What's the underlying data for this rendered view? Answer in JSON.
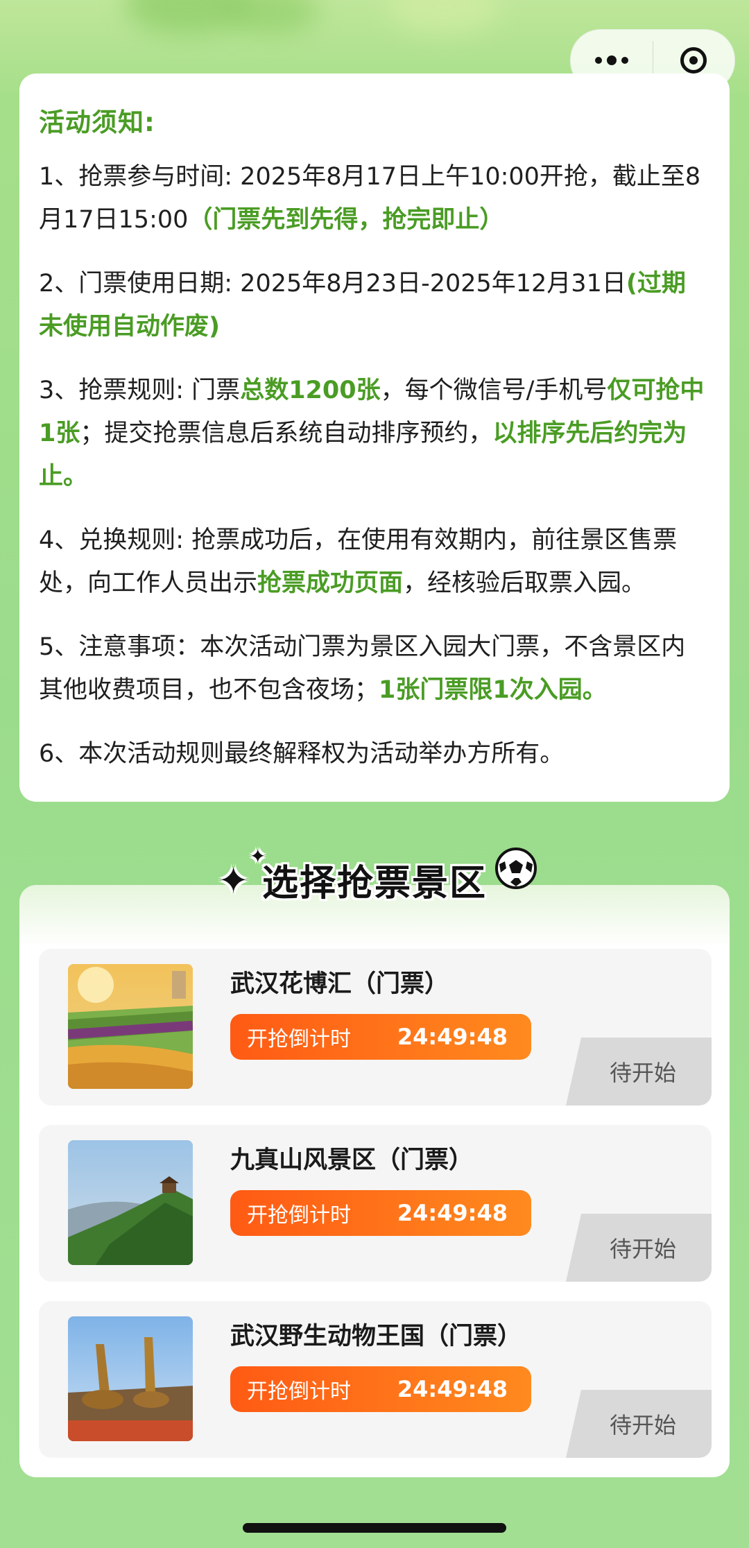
{
  "capsule": {
    "more_icon": "more-dots-icon",
    "close_icon": "target-close-icon"
  },
  "notice": {
    "title": "活动须知:",
    "items": [
      {
        "pre": "1、抢票参与时间: 2025年8月17日上午10:00开抢，截止至8月17日15:00",
        "hl": "（门票先到先得，抢完即止）"
      },
      {
        "pre": "2、门票使用日期: 2025年8月23日-2025年12月31日",
        "hl": "(过期未使用自动作废)"
      },
      {
        "pre": "3、抢票规则: 门票",
        "hl1": "总数1200张",
        "mid1": "，每个微信号/手机号",
        "hl2": "仅可抢中1张",
        "mid2": "；提交抢票信息后系统自动排序预约，",
        "hl3": "以排序先后约完为止。"
      },
      {
        "pre": "4、兑换规则: 抢票成功后，在使用有效期内，前往景区售票处，向工作人员出示",
        "hl": "抢票成功页面",
        "post": "，经核验后取票入园。"
      },
      {
        "pre": "5、注意事项：本次活动门票为景区入园大门票，不含景区内其他收费项目，也不包含夜场；",
        "hl": "1张门票限1次入园。"
      },
      {
        "pre": "6、本次活动规则最终解释权为活动举办方所有。"
      }
    ]
  },
  "section_title": "选择抢票景区",
  "scenic_items": [
    {
      "name": "武汉花博汇（门票）",
      "countdown_label": "开抢倒计时",
      "countdown": "24:49:48",
      "status": "待开始"
    },
    {
      "name": "九真山风景区（门票）",
      "countdown_label": "开抢倒计时",
      "countdown": "24:49:48",
      "status": "待开始"
    },
    {
      "name": "武汉野生动物王国（门票）",
      "countdown_label": "开抢倒计时",
      "countdown": "24:49:48",
      "status": "待开始"
    }
  ],
  "colors": {
    "accent_green": "#4a9c24",
    "countdown_orange": "#ff5a14",
    "status_gray": "#d9d9d9"
  }
}
